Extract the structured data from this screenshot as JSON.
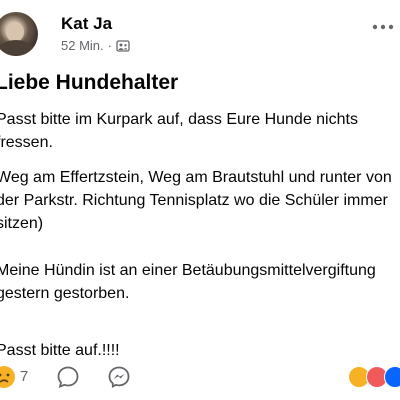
{
  "post": {
    "author": "Kat Ja",
    "time": "52 Min.",
    "separator": "·",
    "title": "Liebe Hundehalter",
    "lines": [
      "Passt bitte im Kurpark auf, dass Eure Hunde nichts",
      "fressen.",
      "Weg am Effertzstein, Weg am Brautstuhl und runter von",
      "der Parkstr. Richtung Tennisplatz wo die Schüler immer",
      "sitzen)",
      "Meine Hündin ist an einer Betäubungsmittelvergiftung",
      "gestern gestorben.",
      "Passt bitte auf.!!!!"
    ]
  },
  "footer": {
    "reaction_count": "7"
  },
  "colors": {
    "text": "#050505",
    "secondary": "#65676b",
    "messenger": "#0866ff",
    "haha_yellow": "#f7b125"
  },
  "icons": [
    "more-options-icon",
    "group-privacy-icon",
    "sad-reaction-icon",
    "comment-icon",
    "messenger-icon",
    "reaction-summary-icons"
  ]
}
